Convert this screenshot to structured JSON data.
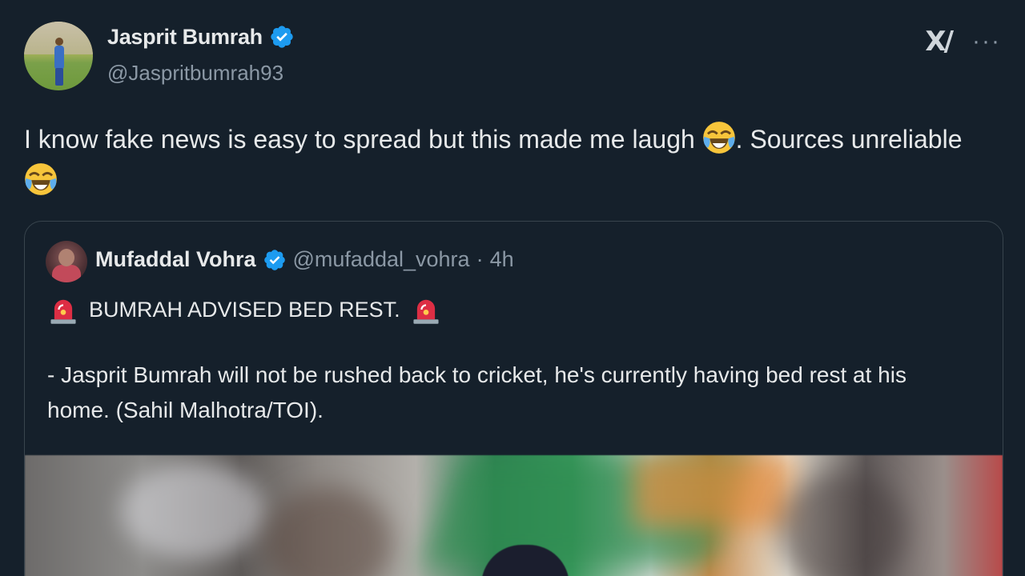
{
  "author": {
    "display_name": "Jasprit Bumrah",
    "handle": "@Jaspritbumrah93",
    "verified": true,
    "avatar_icon": "avatar-photo"
  },
  "actions": {
    "grok_icon": "x-logo-icon",
    "grok_label": "X/",
    "more_icon": "more-icon",
    "more_label": "···"
  },
  "tweet": {
    "text_part1": "I know fake news is easy to spread but this made me laugh ",
    "text_part2": ".  Sources unreliable ",
    "emoji": "face-with-tears-of-joy"
  },
  "quoted_tweet": {
    "display_name": "Mufaddal Vohra",
    "handle": "@mufaddal_vohra",
    "separator": "·",
    "time": "4h",
    "verified": true,
    "headline": "BUMRAH ADVISED BED REST.",
    "headline_icon": "siren-icon",
    "body": "- Jasprit Bumrah will not be rushed back to cricket, he's currently having bed rest at his home. (Sahil Malhotra/TOI).",
    "media_icon": "cricket-photo"
  },
  "colors": {
    "background": "#15202b",
    "text": "#e7e9ea",
    "secondary_text": "#8b98a5",
    "verified_blue": "#1d9bf0",
    "border": "#38444d"
  }
}
